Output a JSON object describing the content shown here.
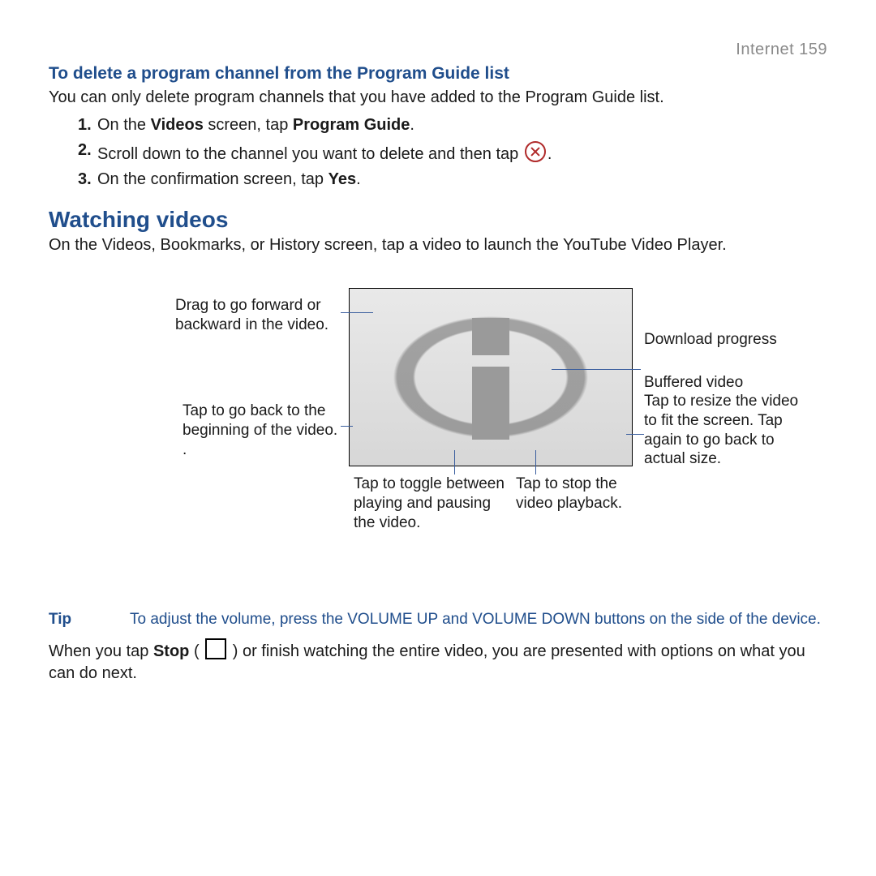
{
  "header": {
    "section": "Internet",
    "page_no": "159"
  },
  "delete_section": {
    "title": "To delete a program channel from the Program Guide list",
    "intro": "You can only delete program channels that you have added to the Program Guide list.",
    "steps": {
      "s1_pre": "On the ",
      "s1_b1": "Videos",
      "s1_mid": " screen, tap ",
      "s1_b2": "Program Guide",
      "s1_post": ".",
      "s2_pre": "Scroll down to the channel you want to delete and then tap ",
      "s2_post": ".",
      "s3_pre": "On the confirmation screen, tap ",
      "s3_b1": "Yes",
      "s3_post": "."
    }
  },
  "watching": {
    "title": "Watching videos",
    "intro": "On the Videos, Bookmarks, or History screen, tap a video to launch the YouTube Video Player."
  },
  "callouts": {
    "drag": "Drag to go forward or backward in the video.",
    "begin": "Tap to go back to the beginning of the video. .",
    "toggle": "Tap to toggle between playing and pausing the video.",
    "stop": "Tap to stop the video playback.",
    "download": "Download progress",
    "buffered": "Buffered video",
    "resize": "Tap to resize the video to fit the screen. Tap again to go back to actual size."
  },
  "tip": {
    "label": "Tip",
    "text": "To adjust the volume, press the VOLUME UP and VOLUME DOWN buttons on the side of the device."
  },
  "after_stop": {
    "pre": "When you tap ",
    "bold": "Stop",
    "mid": " ( ",
    "post": " ) or finish watching the entire video, you are presented with options on what you can do next."
  }
}
